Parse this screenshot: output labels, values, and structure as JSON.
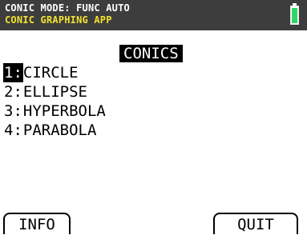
{
  "status_bar": {
    "mode_text": "CONIC MODE: FUNC AUTO",
    "app_text": "CONIC GRAPHING APP",
    "battery_icon": "battery-full-icon",
    "battery_level": 1.0,
    "battery_color": "#2fd66a"
  },
  "menu": {
    "title": "CONICS",
    "selected_index": 0,
    "items": [
      {
        "num": "1:",
        "label": "CIRCLE"
      },
      {
        "num": "2:",
        "label": "ELLIPSE"
      },
      {
        "num": "3:",
        "label": "HYPERBOLA"
      },
      {
        "num": "4:",
        "label": "PARABOLA"
      }
    ]
  },
  "softkeys": {
    "left_label": "INFO",
    "right_label": "QUIT"
  }
}
